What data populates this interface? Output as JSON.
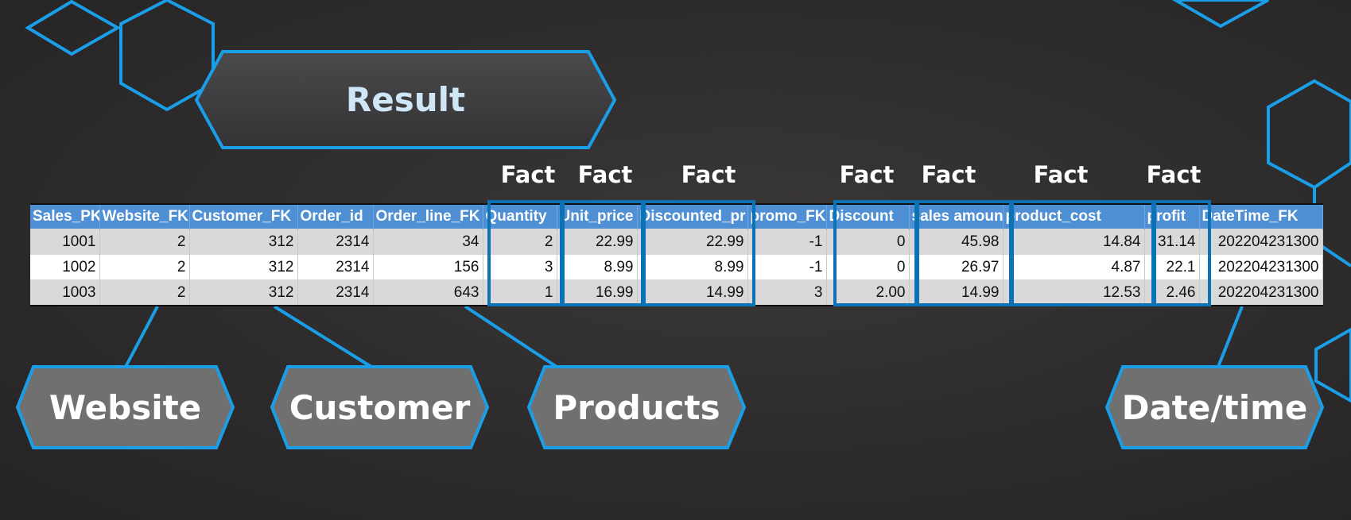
{
  "result_label": "Result",
  "fact_label": "Fact",
  "table": {
    "headers": [
      "Sales_PK",
      "Website_FK",
      "Customer_FK",
      "Order_id",
      "Order_line_FK",
      "Quantity",
      "Unit_price",
      "Discounted_pr",
      "promo_FK",
      "Discount",
      "sales amount",
      "product_cost",
      "profit",
      "DateTime_FK"
    ],
    "rows": [
      [
        "1001",
        "2",
        "312",
        "2314",
        "34",
        "2",
        "22.99",
        "22.99",
        "-1",
        "0",
        "45.98",
        "14.84",
        "31.14",
        "202204231300"
      ],
      [
        "1002",
        "2",
        "312",
        "2314",
        "156",
        "3",
        "8.99",
        "8.99",
        "-1",
        "0",
        "26.97",
        "4.87",
        "22.1",
        "202204231300"
      ],
      [
        "1003",
        "2",
        "312",
        "2314",
        "643",
        "1",
        "16.99",
        "14.99",
        "3",
        "2.00",
        "14.99",
        "12.53",
        "2.46",
        "202204231300"
      ]
    ]
  },
  "dimensions": {
    "website": "Website",
    "customer": "Customer",
    "products": "Products",
    "datetime": "Date/time"
  },
  "colors": {
    "accent": "#1a9ee8",
    "header_bg": "#4f8fd4",
    "fact_border": "#0b72b5",
    "dimension_fill": "#707070"
  }
}
